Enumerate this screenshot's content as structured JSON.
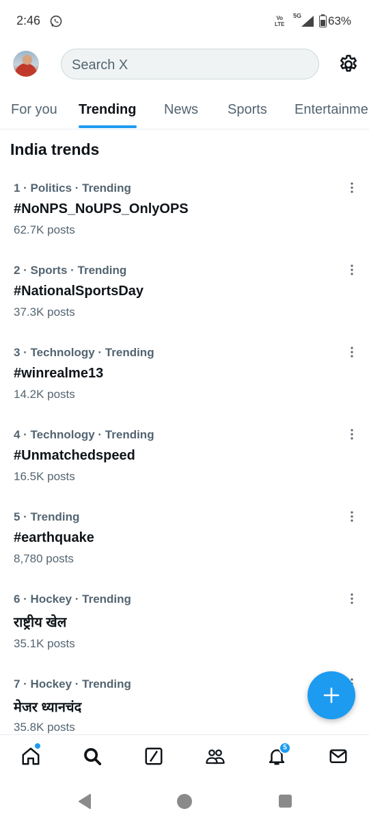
{
  "status_bar": {
    "time": "2:46",
    "volte_top": "Vo",
    "volte_bottom": "LTE",
    "network": "5G",
    "battery": "63%"
  },
  "search": {
    "placeholder": "Search X"
  },
  "tabs": [
    {
      "label": "For you",
      "active": false
    },
    {
      "label": "Trending",
      "active": true
    },
    {
      "label": "News",
      "active": false
    },
    {
      "label": "Sports",
      "active": false
    },
    {
      "label": "Entertainment",
      "active": false
    }
  ],
  "section_title": "India trends",
  "trends": [
    {
      "meta": "1 · Politics · Trending",
      "name": "#NoNPS_NoUPS_OnlyOPS",
      "posts": "62.7K posts"
    },
    {
      "meta": "2 · Sports · Trending",
      "name": "#NationalSportsDay",
      "posts": "37.3K posts"
    },
    {
      "meta": "3 · Technology · Trending",
      "name": "#winrealme13",
      "posts": "14.2K posts"
    },
    {
      "meta": "4 · Technology · Trending",
      "name": "#Unmatchedspeed",
      "posts": "16.5K posts"
    },
    {
      "meta": "5 · Trending",
      "name": "#earthquake",
      "posts": "8,780 posts"
    },
    {
      "meta": "6 · Hockey · Trending",
      "name": "राष्ट्रीय खेल",
      "posts": "35.1K posts"
    },
    {
      "meta": "7 · Hockey · Trending",
      "name": "मेजर ध्यानचंद",
      "posts": "35.8K posts"
    }
  ],
  "bottom_nav": {
    "items": [
      "home-icon",
      "search-icon",
      "grok-icon",
      "communities-icon",
      "notifications-icon",
      "messages-icon"
    ],
    "notification_count": "5"
  },
  "colors": {
    "accent": "#1d9bf0",
    "text_primary": "#0f1419",
    "text_secondary": "#536471"
  }
}
